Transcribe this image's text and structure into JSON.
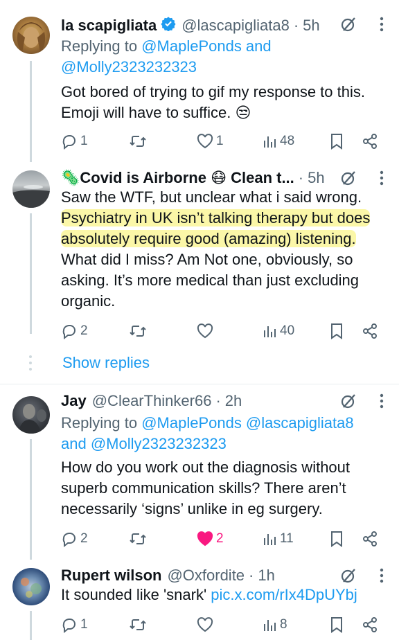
{
  "tweets": [
    {
      "name": "la scapigliata",
      "handle": "@lascapigliata8",
      "time": "5h",
      "reply_prefix": "Replying to ",
      "reply_line1": "@MaplePonds and",
      "reply_line2": "@Molly2323232323",
      "body_line1": "Got bored of trying to gif my response to this.",
      "body_line2": "Emoji will have to suffice. 😒",
      "replies": "1",
      "reposts": "",
      "likes": "1",
      "views": "48"
    },
    {
      "name": "🦠Covid is Airborne 😷 Clean t...",
      "time": "5h",
      "body_line1": "Saw the WTF, but unclear what i said wrong.",
      "body_line2": "Psychiatry in UK isn’t talking therapy but does",
      "body_line3": "absolutely require good  (amazing) listening.",
      "body_line4": "What did I miss? Am Not one, obviously, so",
      "body_line5": "asking. It’s more medical than just excluding",
      "body_line6": "organic.",
      "replies": "2",
      "reposts": "",
      "likes": "",
      "views": "40",
      "show_replies": "Show replies"
    },
    {
      "name": "Jay",
      "handle": "@ClearThinker66",
      "time": "2h",
      "reply_prefix": "Replying to ",
      "reply_line1": "@MaplePonds @lascapigliata8",
      "reply_line2_prefix": "and ",
      "reply_line2": "@Molly2323232323",
      "body_line1": "How do you work out the diagnosis without",
      "body_line2": "superb communication skills? There aren’t",
      "body_line3": "necessarily ‘signs’ unlike in eg surgery.",
      "replies": "2",
      "reposts": "",
      "likes": "2",
      "views": "11"
    },
    {
      "name": "Rupert wilson",
      "handle": "@Oxfordite",
      "time": "1h",
      "body_text": "It sounded like 'snark' ",
      "body_link": "pic.x.com/rIx4DpUYbj",
      "replies": "1",
      "reposts": "",
      "likes": "",
      "views": "8"
    }
  ],
  "separator": "·",
  "colors": {
    "link": "#1d9bf0",
    "like": "#f91880",
    "muted": "#536471",
    "verified": "#1d9bf0"
  }
}
